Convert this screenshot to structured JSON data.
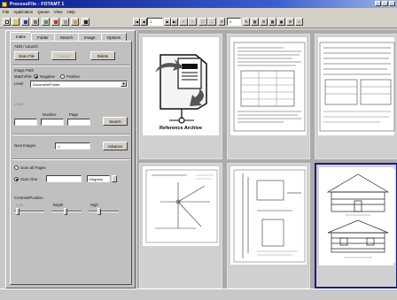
{
  "window": {
    "title": "ProcessFile - FOTAMT 1"
  },
  "menu": [
    "File",
    "Application",
    "Queue",
    "View",
    "Help"
  ],
  "toolbar": {
    "page_field": "1",
    "total_field": "0"
  },
  "tabs": [
    "Index",
    "Folder",
    "Search",
    "Image",
    "Options"
  ],
  "panel": {
    "section_select": "ADD / Launch",
    "scan_file": "Scan File",
    "middle_button": "Cancel",
    "delete_button": "Delete",
    "group_image_path": "Image Path",
    "match_label": "Match/File",
    "radio_negative": "Negative",
    "radio_positive": "Positive",
    "field_level_label": "Level",
    "level_value": "Document/Folder",
    "input_label": "Label",
    "col_header_a": "Number",
    "col_header_b": "Page",
    "search_button": "Search",
    "next_images_label": "Next Images",
    "next_images_value": "1",
    "advance_button": "Advance",
    "scan_all_pages": "Scan all Pages",
    "scan_one": "Scan One",
    "scan_one_value": "",
    "degrees": "Degrees",
    "contrast_label": "Contrast/Position",
    "slider_a_label": "Low",
    "slider_b_label": "Bright",
    "slider_c_label": "High"
  },
  "thumbnails": [
    {
      "caption": "Reference Archive",
      "kind": "logo",
      "selected": false
    },
    {
      "caption": "",
      "kind": "document",
      "selected": false
    },
    {
      "caption": "",
      "kind": "document",
      "selected": false
    },
    {
      "caption": "",
      "kind": "drawing",
      "selected": false
    },
    {
      "caption": "",
      "kind": "drawing",
      "selected": false
    },
    {
      "caption": "",
      "kind": "building",
      "selected": true
    }
  ],
  "colors": {
    "titlebar_start": "#0a1a8c",
    "selection_border": "#1a1a8a",
    "panel_bg": "#c0c0c0",
    "thumb_area_bg": "#ababab"
  }
}
